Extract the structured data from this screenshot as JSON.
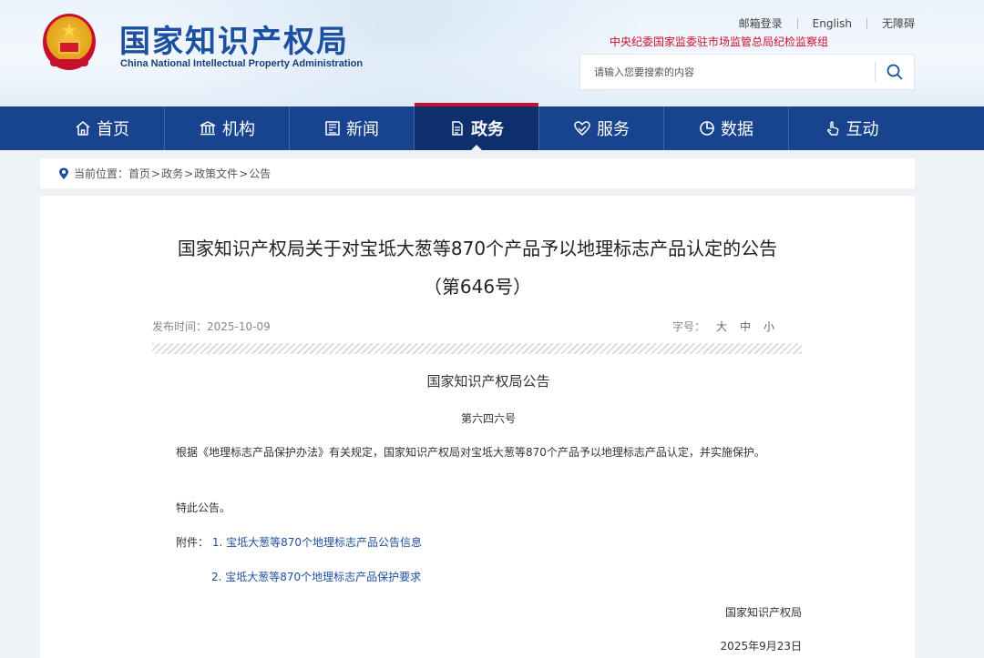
{
  "header": {
    "logo_cn": "国家知识产权局",
    "logo_en": "China National Intellectual Property Administration",
    "links": [
      "邮箱登录",
      "English",
      "无障碍"
    ],
    "supervise": "中央纪委国家监委驻市场监管总局纪检监察组",
    "search_placeholder": "请输入您要搜索的内容"
  },
  "nav": {
    "items": [
      {
        "label": "首页",
        "icon": "home-icon"
      },
      {
        "label": "机构",
        "icon": "institution-icon"
      },
      {
        "label": "新闻",
        "icon": "news-icon"
      },
      {
        "label": "政务",
        "icon": "document-icon"
      },
      {
        "label": "服务",
        "icon": "service-icon"
      },
      {
        "label": "数据",
        "icon": "pie-chart-icon"
      },
      {
        "label": "互动",
        "icon": "hand-icon"
      }
    ],
    "active_index": 3
  },
  "breadcrumb": {
    "prefix": "当前位置：",
    "items": [
      "首页",
      "政务",
      "政策文件",
      "公告"
    ]
  },
  "article": {
    "title_line1": "国家知识产权局关于对宝坻大葱等870个产品予以地理标志产品认定的公告",
    "title_line2": "（第646号）",
    "date_label": "发布时间：",
    "date": "2025-10-09",
    "fontsize_label": "字号：",
    "fontsize_options": [
      "大",
      "中",
      "小"
    ],
    "notice_title": "国家知识产权局公告",
    "notice_no": "第六四六号",
    "body": "根据《地理标志产品保护办法》有关规定，国家知识产权局对宝坻大葱等870个产品予以地理标志产品认定，并实施保护。",
    "ending": "特此公告。",
    "attachment_label": "附件：",
    "attachments": [
      "1. 宝坻大葱等870个地理标志产品公告信息",
      "2. 宝坻大葱等870个地理标志产品保护要求"
    ],
    "signature": "国家知识产权局",
    "sign_date": "2025年9月23日"
  },
  "colors": {
    "nav_bg": "#17438f",
    "nav_active": "#0d2f6d",
    "accent_red": "#c8102e",
    "link_blue": "#1f4e9c",
    "logo_blue": "#1c4fa0"
  }
}
